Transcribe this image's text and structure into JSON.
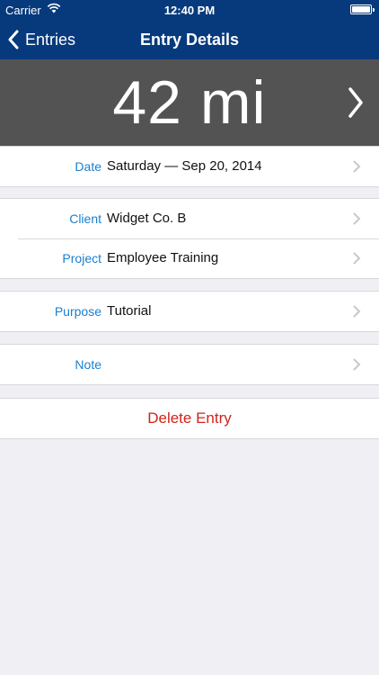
{
  "status_bar": {
    "carrier": "Carrier",
    "time": "12:40 PM"
  },
  "nav": {
    "back_label": "Entries",
    "title": "Entry Details"
  },
  "banner": {
    "value": "42 mi"
  },
  "rows": {
    "date": {
      "label": "Date",
      "value": "Saturday — Sep 20, 2014"
    },
    "client": {
      "label": "Client",
      "value": "Widget Co. B"
    },
    "project": {
      "label": "Project",
      "value": "Employee Training"
    },
    "purpose": {
      "label": "Purpose",
      "value": "Tutorial"
    },
    "note": {
      "label": "Note",
      "value": ""
    }
  },
  "actions": {
    "delete_label": "Delete Entry"
  },
  "colors": {
    "nav_background": "#073a7c",
    "banner_background": "#535353",
    "label_blue": "#1a7fd1",
    "delete_red": "#d0231b",
    "page_background": "#efeff4"
  },
  "icons": {
    "status": [
      "wifi-icon",
      "battery-icon"
    ],
    "nav": "back-chevron-icon",
    "rows": "chevron-right-icon"
  }
}
